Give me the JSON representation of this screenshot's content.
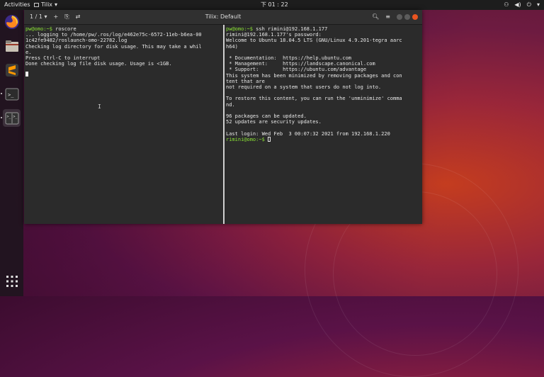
{
  "topbar": {
    "activities": "Activities",
    "app_name": "Tilix",
    "clock": "下 01 : 22"
  },
  "dock": {
    "items": [
      "firefox-icon",
      "files-icon",
      "sublime-text-icon",
      "terminal-icon",
      "tilix-icon",
      "show-apps-icon"
    ]
  },
  "window": {
    "title": "Tilix: Default",
    "session_label": "1 / 1"
  },
  "left_pane": {
    "lines": [
      "pw@omo:~$ roscore",
      "... logging to /home/pw/.ros/log/e462e75c-6572-11eb-b6ea-00",
      "1c42fe9482/roslaunch-omo-22782.log",
      "Checking log directory for disk usage. This may take a whil",
      "e.",
      "Press Ctrl-C to interrupt",
      "Done checking log file disk usage. Usage is <1GB."
    ]
  },
  "right_pane": {
    "lines": [
      "pw@omo:~$ ssh rimini@192.168.1.177",
      "rimini@192.168.1.177's password:",
      "Welcome to Ubuntu 18.04.5 LTS (GNU/Linux 4.9.201-tegra aarc",
      "h64)",
      "",
      " * Documentation:  https://help.ubuntu.com",
      " * Management:     https://landscape.canonical.com",
      " * Support:        https://ubuntu.com/advantage",
      "This system has been minimized by removing packages and con",
      "tent that are",
      "not required on a system that users do not log into.",
      "",
      "To restore this content, you can run the 'unminimize' comma",
      "nd.",
      "",
      "96 packages can be updated.",
      "52 updates are security updates.",
      "",
      "Last login: Wed Feb  3 00:07:32 2021 from 192.168.1.220"
    ],
    "final_prompt": "rimini@omo:~$ "
  },
  "colors": {
    "prompt_green": "#8ae234",
    "accent_orange": "#e95420"
  }
}
